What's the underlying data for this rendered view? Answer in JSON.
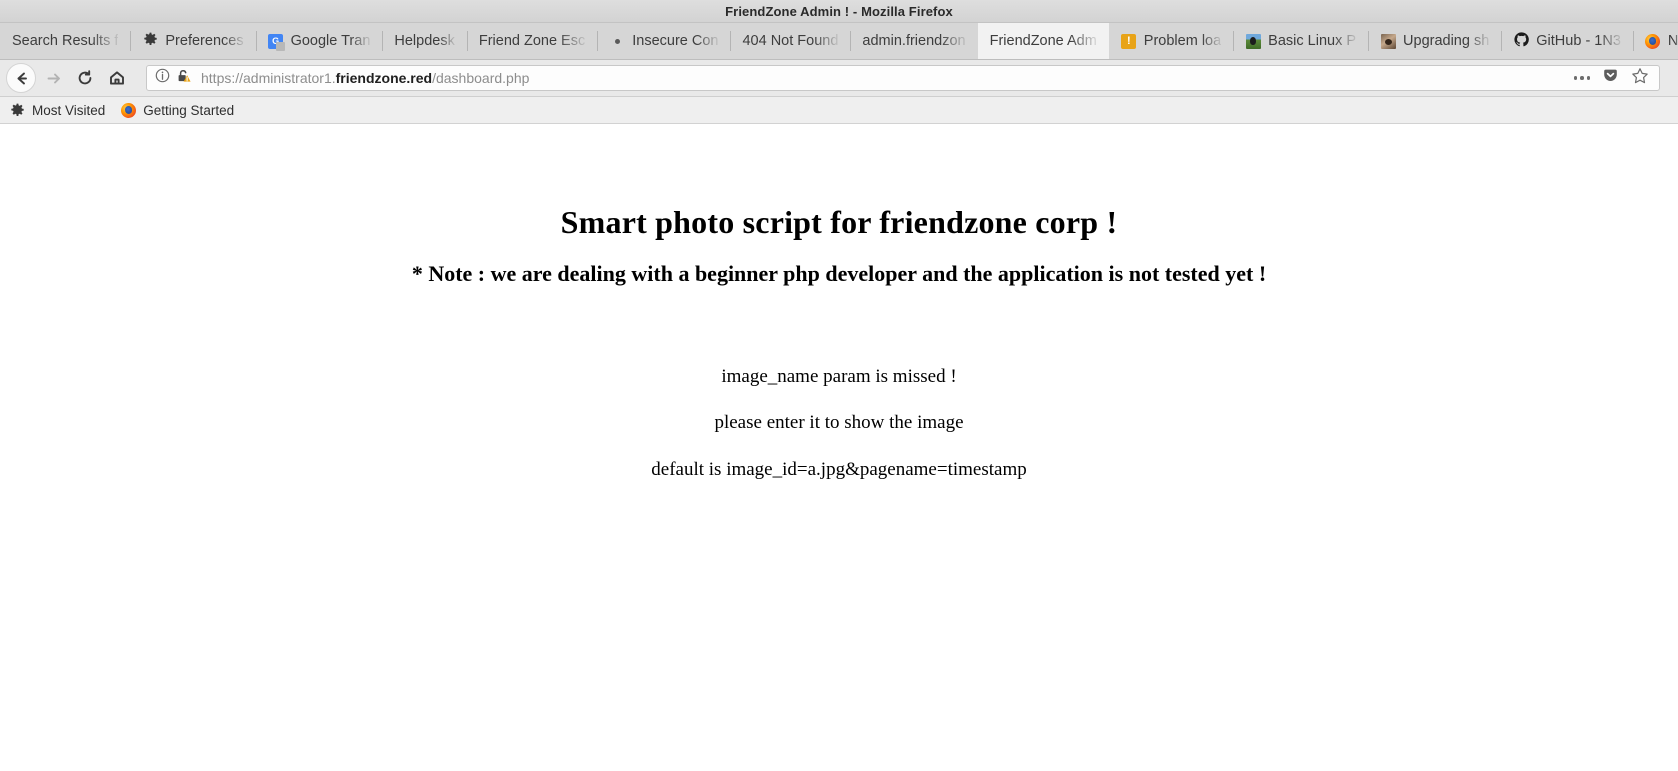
{
  "window": {
    "title": "FriendZone Admin ! - Mozilla Firefox"
  },
  "tabs": [
    {
      "label": "Search Results f",
      "icon": "none",
      "active": false
    },
    {
      "label": "Preferences",
      "icon": "gear-icon",
      "active": false
    },
    {
      "label": "Google Tran",
      "icon": "google-translate-icon",
      "active": false
    },
    {
      "label": "Helpdesk",
      "icon": "none",
      "active": false
    },
    {
      "label": "Friend Zone Esc",
      "icon": "none",
      "active": false
    },
    {
      "label": "Insecure Con",
      "icon": "dot-icon",
      "active": false
    },
    {
      "label": "404 Not Found",
      "icon": "none",
      "active": false
    },
    {
      "label": "admin.friendzon",
      "icon": "none",
      "active": false
    },
    {
      "label": "FriendZone Adm",
      "icon": "none",
      "active": true
    },
    {
      "label": "Problem loa",
      "icon": "warning-icon",
      "active": false
    },
    {
      "label": "Basic Linux P",
      "icon": "linux-thumbnail-icon",
      "active": false
    },
    {
      "label": "Upgrading sh",
      "icon": "dog-thumbnail-icon",
      "active": false
    },
    {
      "label": "GitHub - 1N3",
      "icon": "github-icon",
      "active": false
    },
    {
      "label": "N",
      "icon": "firefox-icon",
      "active": false
    }
  ],
  "navigation": {
    "back_icon": "back-arrow-icon",
    "forward_icon": "forward-arrow-icon",
    "reload_icon": "reload-icon",
    "home_icon": "home-icon"
  },
  "urlbar": {
    "info_icon": "info-circle-icon",
    "security_icon": "broken-lock-warning-icon",
    "url_prefix": "https://administrator1.",
    "url_host": "friendzone.red",
    "url_suffix": "/dashboard.php",
    "page_actions_icon": "ellipsis-icon",
    "pocket_icon": "pocket-save-icon",
    "bookmark_icon": "star-icon"
  },
  "bookmarks": [
    {
      "label": "Most Visited",
      "icon": "gear-icon"
    },
    {
      "label": "Getting Started",
      "icon": "firefox-icon"
    }
  ],
  "page": {
    "heading": "Smart photo script for friendzone corp !",
    "note": "* Note : we are dealing with a beginner php developer and the application is not tested yet !",
    "lines": [
      "image_name param is missed !",
      "please enter it to show the image",
      "default is image_id=a.jpg&pagename=timestamp"
    ]
  },
  "colors": {
    "chrome_bg": "#d6d6d6",
    "active_tab_bg": "#f2f2f2",
    "navbar_bg": "#e9e9e9",
    "bookmarks_bg": "#efefef",
    "page_bg": "#ffffff",
    "warning_accent": "#e8a317",
    "link_blue": "#4285f4"
  }
}
